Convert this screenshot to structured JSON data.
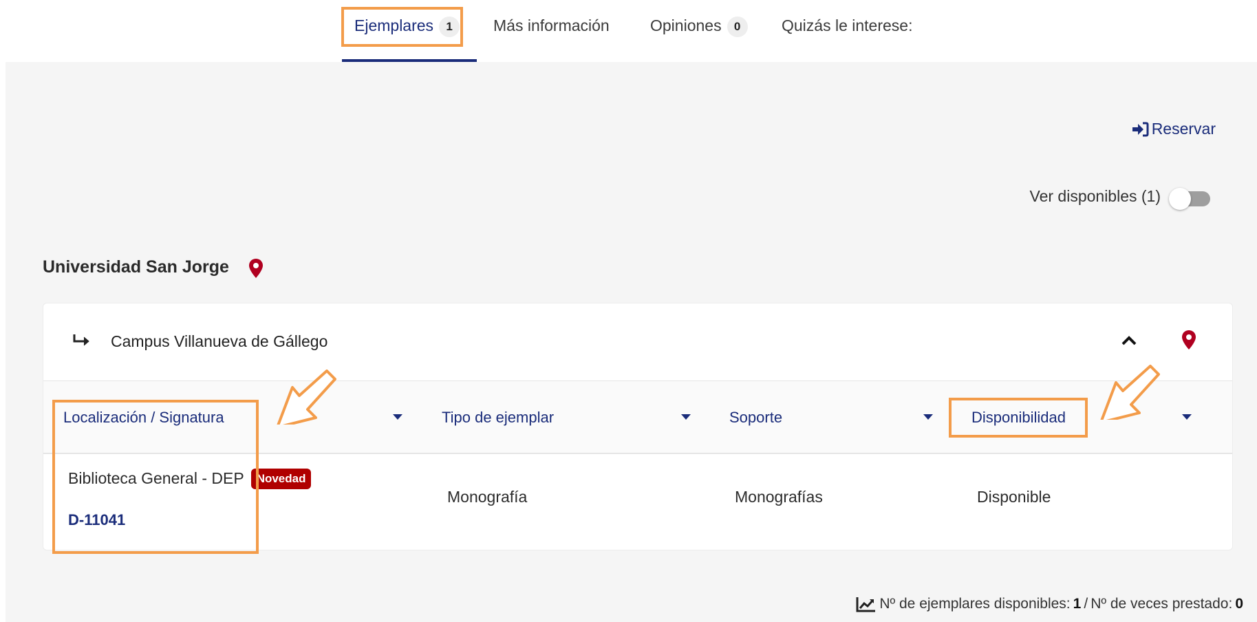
{
  "tabs": [
    {
      "label": "Ejemplares",
      "badge": "1"
    },
    {
      "label": "Más información"
    },
    {
      "label": "Opiniones",
      "badge": "0"
    },
    {
      "label": "Quizás le interese:"
    }
  ],
  "actions": {
    "reserve_label": "Reservar"
  },
  "filter": {
    "toggle_label": "Ver disponibles (1)",
    "toggle_on": false
  },
  "organization": {
    "name": "Universidad San Jorge"
  },
  "campus": {
    "name": "Campus Villanueva de Gállego"
  },
  "table": {
    "headers": [
      "Localización / Signatura",
      "Tipo de ejemplar",
      "Soporte",
      "Disponibilidad"
    ],
    "rows": [
      {
        "location": "Biblioteca General - DEP",
        "tag": "Novedad",
        "signature": "D-11041",
        "type": "Monografía",
        "support": "Monografías",
        "availability": "Disponible"
      }
    ]
  },
  "footer": {
    "available_label": "Nº de ejemplares disponibles:",
    "available_count": "1",
    "separator": "/",
    "loaned_label": "Nº de veces prestado:",
    "loaned_count": "0"
  },
  "colors": {
    "primary": "#1a2c7a",
    "pin": "#b00020",
    "tag": "#b00000",
    "highlight": "#f39c4a"
  }
}
